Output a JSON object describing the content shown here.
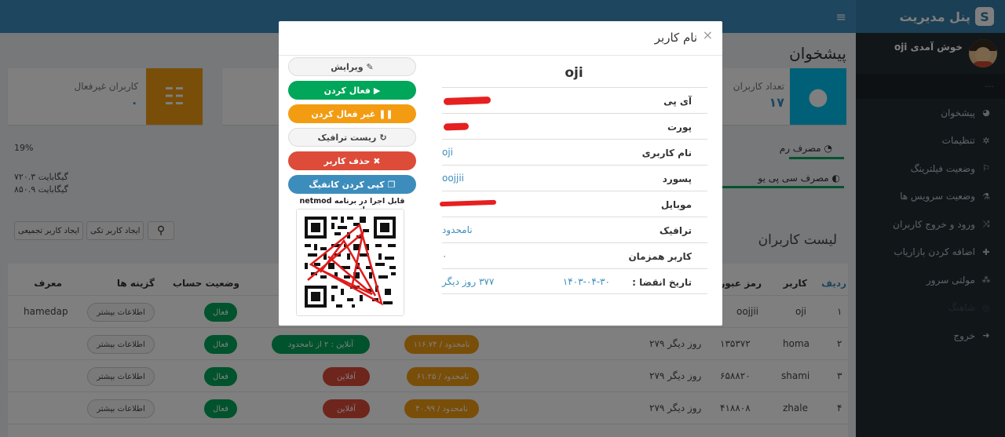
{
  "brand": {
    "title": "پنل مدیریت",
    "badge": "S"
  },
  "topbar": {
    "toggle_icon": "bars-icon"
  },
  "sidebar": {
    "welcome": "خوش آمدی oji",
    "header": "---",
    "items": [
      {
        "label": "پیشخوان",
        "icon": "dashboard-icon"
      },
      {
        "label": "تنظیمات",
        "icon": "gear-icon"
      },
      {
        "label": "وضعیت فیلترینگ",
        "icon": "flag-icon"
      },
      {
        "label": "وضعیت سرویس ها",
        "icon": "flask-icon"
      },
      {
        "label": "ورود و خروج کاربران",
        "icon": "shuffle-icon"
      },
      {
        "label": "اضافه کردن بازاریاب",
        "icon": "plus-icon"
      },
      {
        "label": "مولتی سرور",
        "icon": "sitemap-icon"
      },
      {
        "label": "شاهنگ",
        "icon": "globe-icon"
      },
      {
        "label": "خروج",
        "icon": "logout-icon"
      }
    ]
  },
  "content": {
    "page_title": "پیشخوان",
    "box_users": {
      "label": "تعداد کاربران",
      "value": "۱۷"
    },
    "box_inactive": {
      "label": "کاربران غیرفعال",
      "value": "۰"
    },
    "ram_label": "مصرف رم",
    "cpu_label": "مصرف سی پی یو",
    "percent": "19%",
    "traffic1": "۷۲۰.۳ گیگابایت",
    "traffic2": "۸۵۰.۹ گیگابایت",
    "list_title": "لیست کاربران",
    "btn_bulk": "ایجاد کاربر تجمیعی",
    "btn_single": "ایجاد کاربر تکی",
    "headers": {
      "row": "ردیف",
      "user": "کاربر",
      "pass": "رمز عبور",
      "status": "وضعیت حساب",
      "options": "گزینه ها",
      "ref": "معرف"
    },
    "rows": [
      {
        "no": "۱",
        "user": "oji",
        "pass": "oojjii",
        "status": "فعال",
        "more": "اطلاعات بیشتر",
        "ref": "hamedap"
      },
      {
        "no": "۲",
        "user": "homa",
        "pass": "۱۳۵۳۷۲",
        "days": "۲۷۹ روز دیگر",
        "traffic": "۱۱۶.۷۴ / نامحدود",
        "online": "آنلاین : ۲ از نامحدود",
        "status": "فعال",
        "more": "اطلاعات بیشتر"
      },
      {
        "no": "۳",
        "user": "shami",
        "pass": "۶۵۸۸۲۰",
        "days": "۲۷۹ روز دیگر",
        "traffic": "۶۱.۲۵ / نامحدود",
        "online": "آفلاین",
        "status": "فعال",
        "more": "اطلاعات بیشتر"
      },
      {
        "no": "۴",
        "user": "zhale",
        "pass": "۴۱۸۸۰۸",
        "days": "۲۷۹ روز دیگر",
        "traffic": "۴۰.۹۹ / نامحدود",
        "online": "آفلاین",
        "status": "فعال",
        "more": "اطلاعات بیشتر"
      }
    ]
  },
  "modal": {
    "title": "نام کاربر",
    "close": "×",
    "username": "oji",
    "rows": {
      "ip": "آی پی",
      "port": "پورت",
      "user_label": "نام کاربری",
      "user_value": "oji",
      "pass_label": "پسورد",
      "pass_value": "oojjii",
      "mobile": "موبایل",
      "traffic_label": "ترافیک",
      "traffic_value": "نامحدود",
      "concurrent_label": "کاربر همزمان",
      "concurrent_value": "۰",
      "expire_label": "تاریخ انقضا :",
      "expire_date": "۱۴۰۳-۰۴-۳۰",
      "expire_days": "۳۷۷ روز دیگر"
    },
    "buttons": {
      "edit": "ویرایش",
      "activate": "فعال کردن",
      "deactivate": "غیر فعال کردن",
      "reset": "ریست ترافیک",
      "delete": "حذف کاربر",
      "copy": "کپی کردن کانفیگ"
    },
    "qr_note": "قابل اجرا در برنامه netmod اندروید"
  },
  "colors": {
    "primary": "#3c8dbc",
    "success": "#00a65a",
    "warning": "#f39c12",
    "danger": "#dd4b39",
    "sidebar": "#222d32"
  }
}
